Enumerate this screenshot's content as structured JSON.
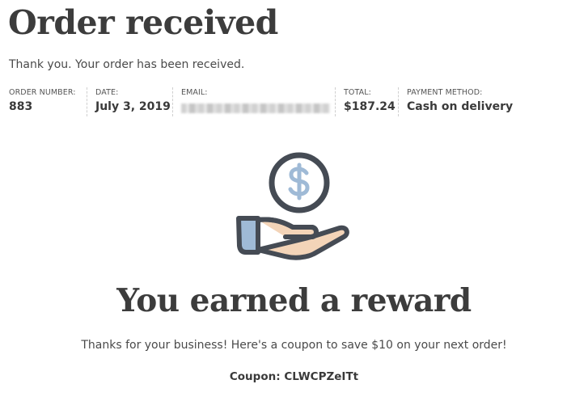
{
  "page": {
    "title": "Order received",
    "thanks_message": "Thank you. Your order has been received."
  },
  "order_details": {
    "order_number_label": "ORDER NUMBER:",
    "order_number": "883",
    "date_label": "DATE:",
    "date": "July 3, 2019",
    "email_label": "EMAIL:",
    "total_label": "TOTAL:",
    "total": "$187.24",
    "payment_method_label": "PAYMENT METHOD:",
    "payment_method": "Cash on delivery"
  },
  "reward": {
    "icon": "hand-holding-dollar-icon",
    "title": "You earned a reward",
    "message": "Thanks for your business! Here's a coupon to save $10 on your next order!",
    "coupon_label": "Coupon:",
    "coupon_code": "CLWCPZeITt"
  },
  "colors": {
    "heading": "#3c3c3c",
    "icon_outline": "#454b54",
    "icon_accent": "#9fbad6",
    "hand_skin": "#f3d4b8",
    "sleeve": "#9fbad6"
  }
}
